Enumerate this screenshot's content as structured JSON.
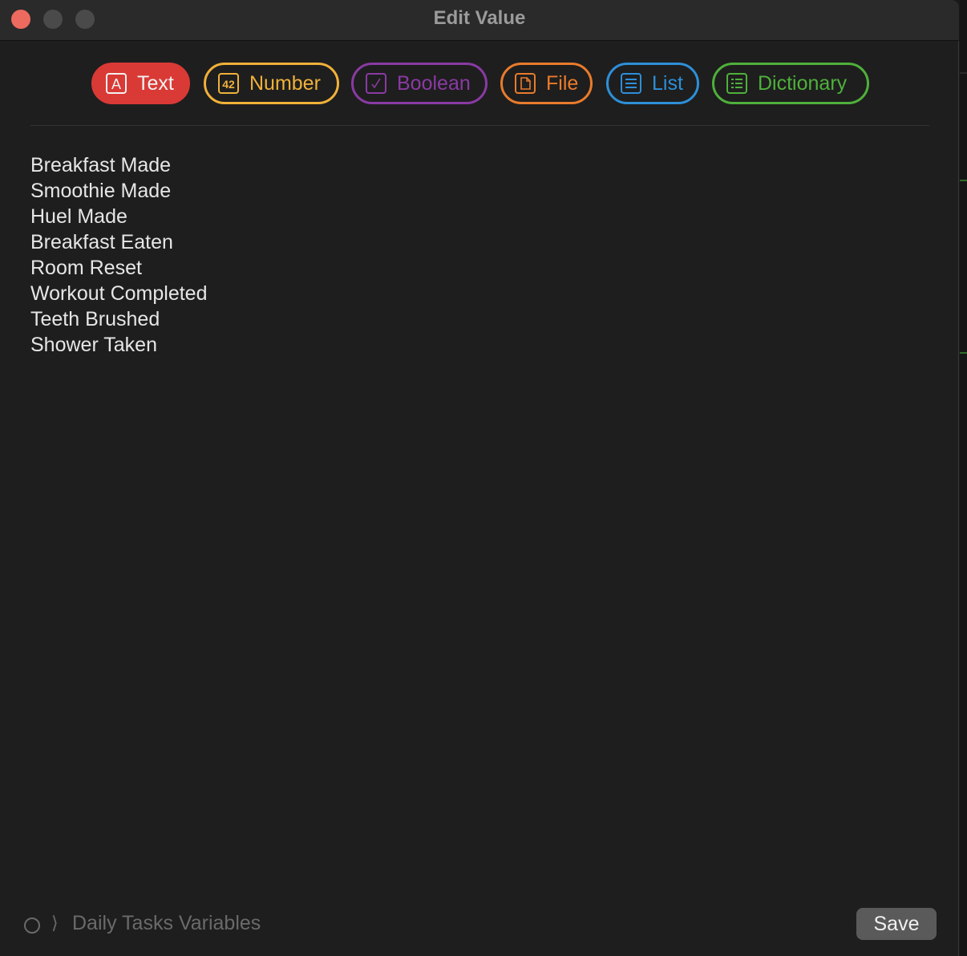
{
  "window": {
    "title": "Edit Value"
  },
  "types": [
    {
      "label": "Text",
      "icon": "text-a-icon",
      "color": "#d93a36",
      "selected": true
    },
    {
      "label": "Number",
      "icon": "number-42-icon",
      "color": "#f0b13a",
      "selected": false
    },
    {
      "label": "Boolean",
      "icon": "checkbox-icon",
      "color": "#8a3aa3",
      "selected": false
    },
    {
      "label": "File",
      "icon": "file-icon",
      "color": "#e97b2c",
      "selected": false
    },
    {
      "label": "List",
      "icon": "list-icon",
      "color": "#2e8fd8",
      "selected": false
    },
    {
      "label": "Dictionary",
      "icon": "dictionary-icon",
      "color": "#4fb03b",
      "selected": false
    }
  ],
  "editor": {
    "lines": [
      "Breakfast Made",
      "Smoothie Made",
      "Huel Made",
      "Breakfast Eaten",
      "Room Reset",
      "Workout Completed",
      "Teeth Brushed",
      "Shower Taken"
    ]
  },
  "footer": {
    "breadcrumb": "Daily Tasks Variables",
    "chevron": "⟩",
    "save_label": "Save"
  }
}
